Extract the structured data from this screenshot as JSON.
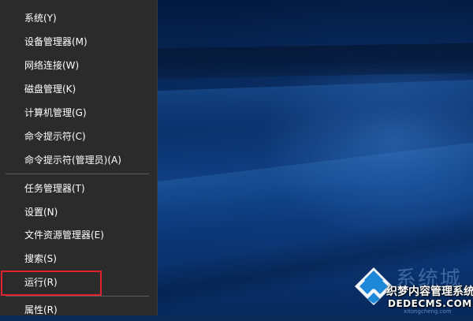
{
  "menu": {
    "items": [
      {
        "id": "system",
        "label": "系统(Y)"
      },
      {
        "id": "device-manager",
        "label": "设备管理器(M)"
      },
      {
        "id": "network-connections",
        "label": "网络连接(W)"
      },
      {
        "id": "disk-management",
        "label": "磁盘管理(K)"
      },
      {
        "id": "computer-management",
        "label": "计算机管理(G)"
      },
      {
        "id": "command-prompt",
        "label": "命令提示符(C)"
      },
      {
        "id": "command-prompt-admin",
        "label": "命令提示符(管理员)(A)"
      },
      {
        "id": "task-manager",
        "label": "任务管理器(T)"
      },
      {
        "id": "settings",
        "label": "设置(N)"
      },
      {
        "id": "file-explorer",
        "label": "文件资源管理器(E)"
      },
      {
        "id": "search",
        "label": "搜索(S)"
      },
      {
        "id": "run",
        "label": "运行(R)",
        "highlighted": true
      },
      {
        "id": "properties",
        "label": "属性(R)"
      }
    ]
  },
  "colors": {
    "menu_background": "#2b2b2b",
    "menu_text": "#ffffff",
    "separator": "#5a5a5a",
    "highlight_border": "#e0242b",
    "wallpaper": "#0b3573"
  },
  "watermark": {
    "big_text": "系统城",
    "overlay_text": "织梦内容管理系统",
    "url": "DEDECMS.COM",
    "small_url": "xitongcheng.com"
  }
}
